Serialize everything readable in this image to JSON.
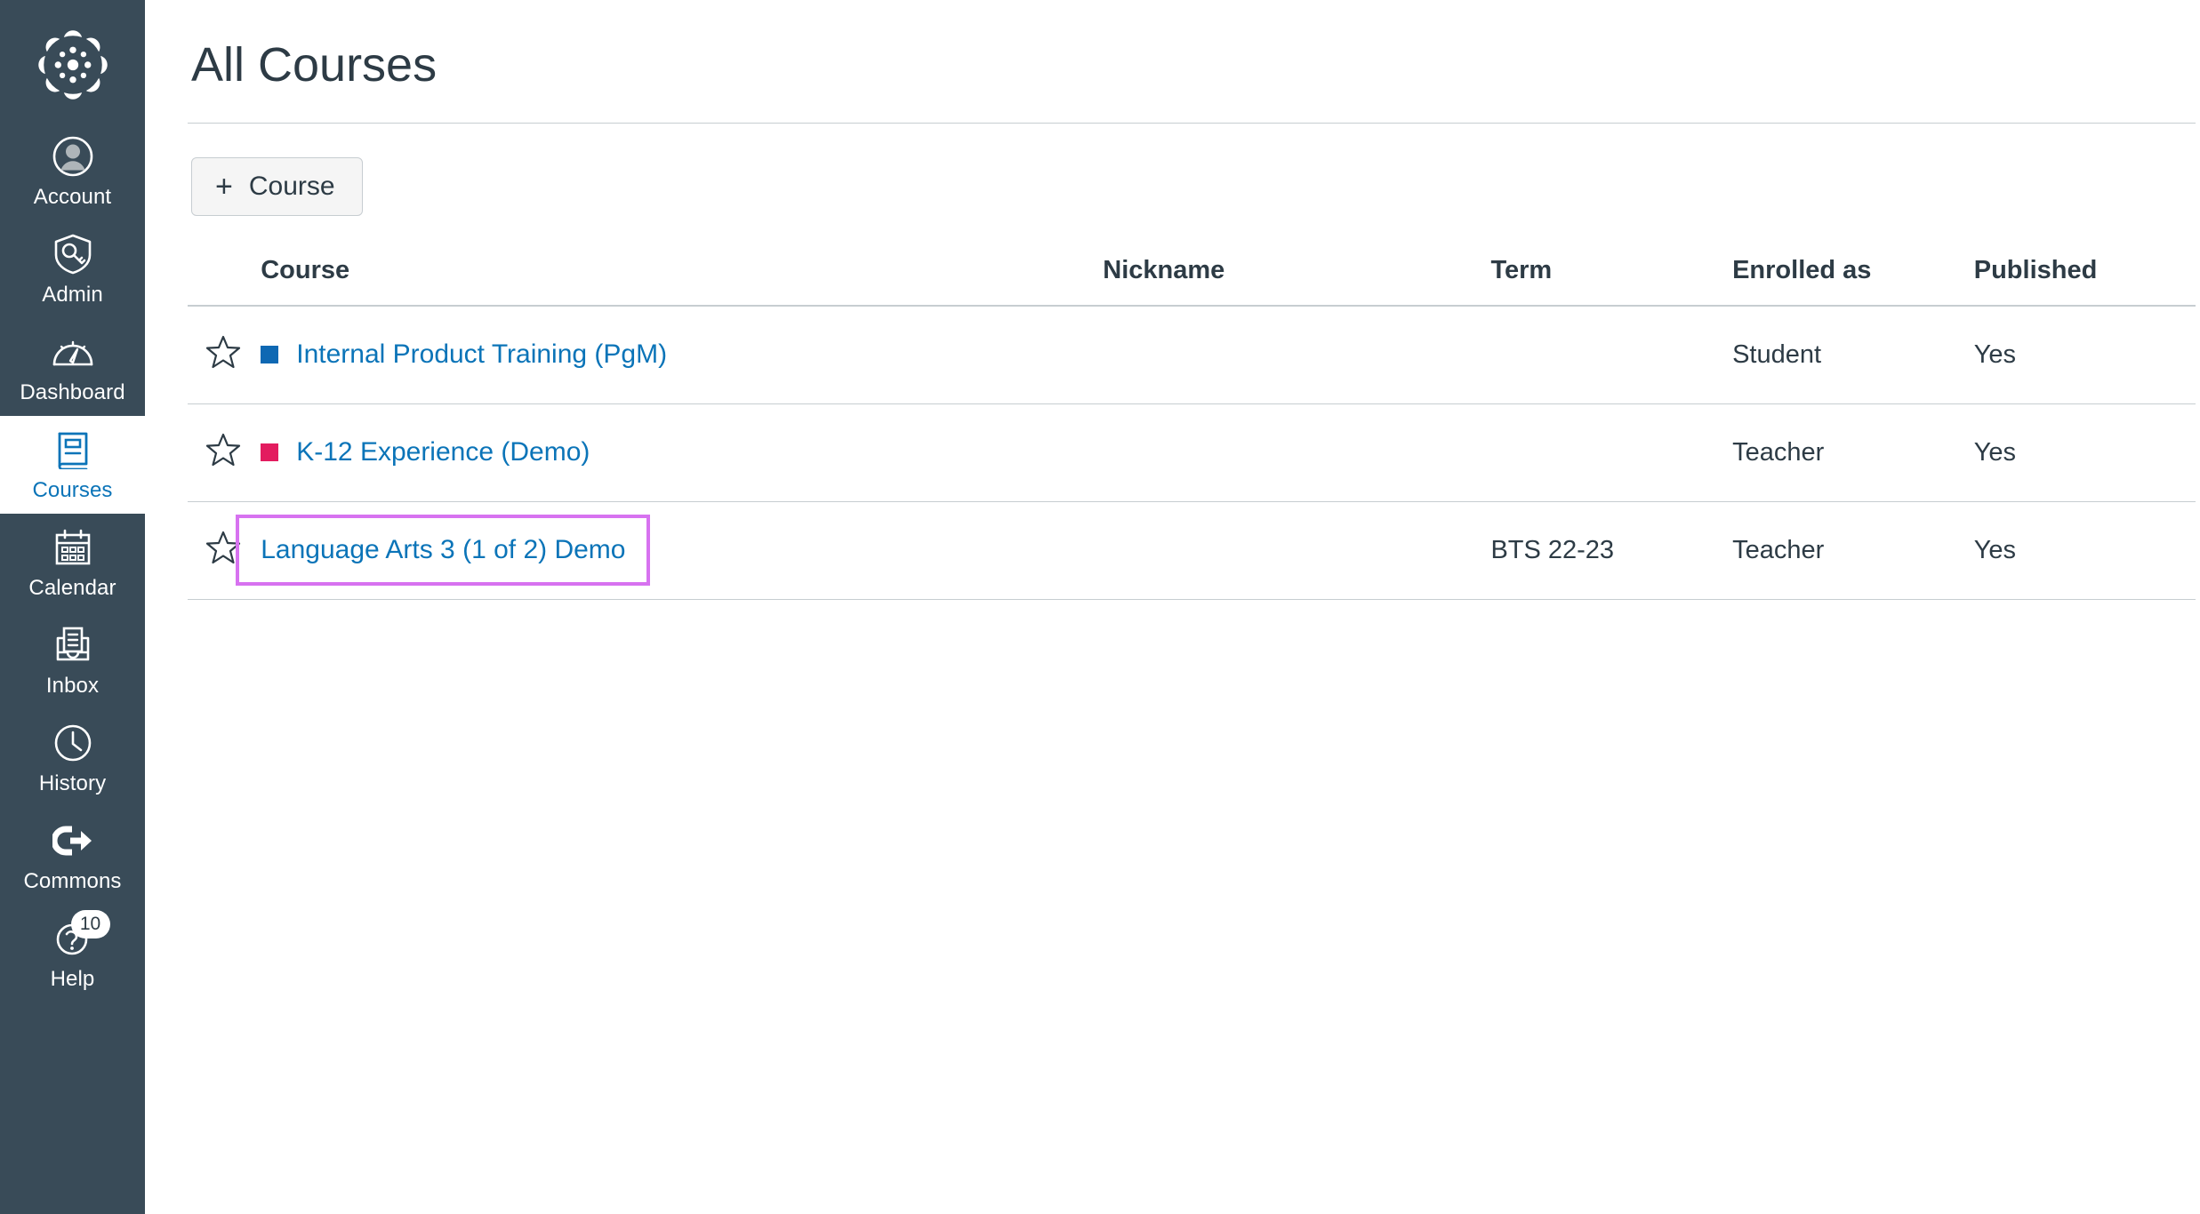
{
  "sidebar": {
    "logo_name": "canvas-logo",
    "items": [
      {
        "label": "Account",
        "icon": "account-avatar-icon",
        "active": false
      },
      {
        "label": "Admin",
        "icon": "shield-key-icon",
        "active": false
      },
      {
        "label": "Dashboard",
        "icon": "gauge-icon",
        "active": false
      },
      {
        "label": "Courses",
        "icon": "book-icon",
        "active": true
      },
      {
        "label": "Calendar",
        "icon": "calendar-icon",
        "active": false
      },
      {
        "label": "Inbox",
        "icon": "inbox-tray-icon",
        "active": false
      },
      {
        "label": "History",
        "icon": "clock-icon",
        "active": false
      },
      {
        "label": "Commons",
        "icon": "commons-arrow-icon",
        "active": false
      },
      {
        "label": "Help",
        "icon": "question-circle-icon",
        "active": false,
        "badge": "10"
      }
    ]
  },
  "main": {
    "page_title": "All Courses",
    "add_course_button": {
      "plus": "+",
      "label": "Course"
    },
    "table": {
      "headers": {
        "star": "",
        "course": "Course",
        "nickname": "Nickname",
        "term": "Term",
        "enrolled_as": "Enrolled as",
        "published": "Published"
      },
      "rows": [
        {
          "star": "star-outline-icon",
          "color": "#0E68B3",
          "has_color": true,
          "course": "Internal Product Training (PgM)",
          "nickname": "",
          "term": "",
          "enrolled_as": "Student",
          "published": "Yes",
          "focused": false
        },
        {
          "star": "star-outline-icon",
          "color": "#E31C5F",
          "has_color": true,
          "course": "K-12 Experience (Demo)",
          "nickname": "",
          "term": "",
          "enrolled_as": "Teacher",
          "published": "Yes",
          "focused": false
        },
        {
          "star": "star-outline-icon",
          "color": "",
          "has_color": false,
          "course": "Language Arts 3 (1 of 2) Demo",
          "nickname": "",
          "term": "BTS 22-23",
          "enrolled_as": "Teacher",
          "published": "Yes",
          "focused": true
        }
      ]
    }
  },
  "colors": {
    "sidebar_bg": "#394B58",
    "link_blue": "#0B74B8",
    "text_dark": "#2D3B45",
    "border_gray": "#C7CDD1",
    "focus_ring": "#D772F0"
  }
}
